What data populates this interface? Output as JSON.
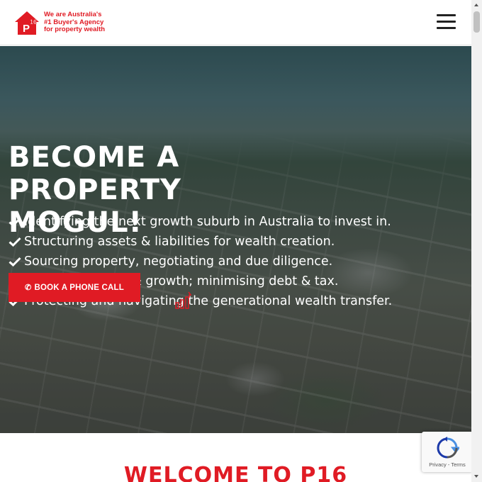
{
  "header": {
    "logo": {
      "badge": "P16",
      "tagline_lines": [
        "We are Australia's",
        "#1 Buyer's Agency",
        "for property wealth"
      ]
    },
    "menu_icon": "hamburger-menu-icon"
  },
  "hero": {
    "title_lines": [
      "BECOME A",
      "PROPERTY",
      "MOGUL!"
    ],
    "features": [
      "Identifying the next growth suburb in Australia to invest in.",
      "Structuring assets & liabilities for wealth creation.",
      "Sourcing property, negotiating and due diligence.",
      "Maximising yield & growth; minimising debt & tax.",
      "Protecting and navigating the generational wealth transfer."
    ],
    "cta_label": "BOOK A PHONE CALL",
    "cta_icon": "phone-icon"
  },
  "welcome": {
    "title": "WELCOME TO P16"
  },
  "recaptcha": {
    "links": "Privacy - Terms"
  },
  "colors": {
    "brand_red": "#e01b24",
    "header_bg": "#ffffff",
    "hero_text": "#ffffff"
  }
}
